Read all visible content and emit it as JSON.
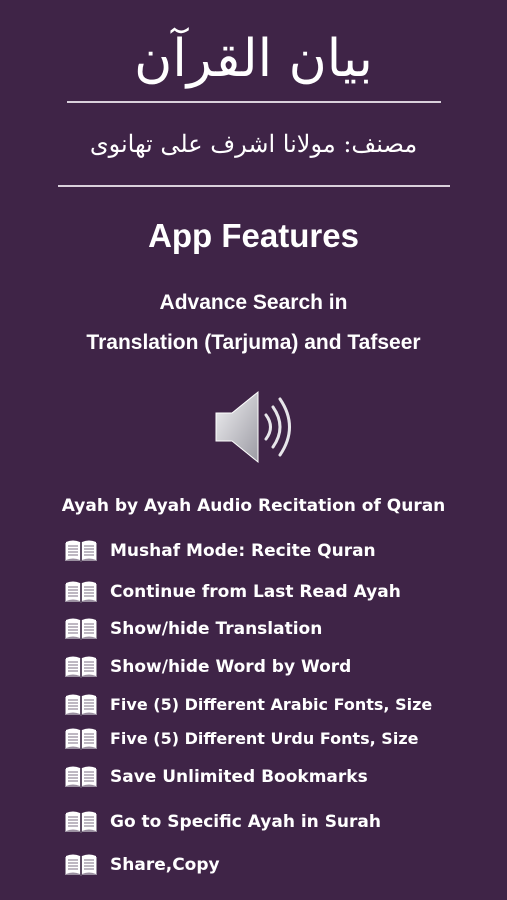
{
  "header": {
    "title": "بیان القرآن",
    "author": "مصنف: مولانا اشرف علی تھانوی"
  },
  "features_heading": "App Features",
  "search": {
    "line1": "Advance Search in",
    "line2": "Translation (Tarjuma) and Tafseer"
  },
  "audio": {
    "icon": "speaker-icon",
    "label": "Ayah by Ayah Audio Recitation of Quran"
  },
  "features": {
    "icon": "open-book-icon",
    "items": [
      {
        "label": "Mushaf Mode: Recite Quran"
      },
      {
        "label": "Continue from Last Read Ayah"
      },
      {
        "label": "Show/hide Translation"
      },
      {
        "label": "Show/hide Word by Word"
      },
      {
        "label": "Five (5) Different Arabic Fonts, Size"
      },
      {
        "label": "Five (5) Different Urdu Fonts, Size"
      },
      {
        "label": "Save Unlimited Bookmarks"
      },
      {
        "label": "Go to Specific Ayah in Surah"
      },
      {
        "label": "Share,Copy"
      }
    ]
  },
  "colors": {
    "background": "#3f2447",
    "text": "#ffffff",
    "divider": "#d9d0db"
  }
}
